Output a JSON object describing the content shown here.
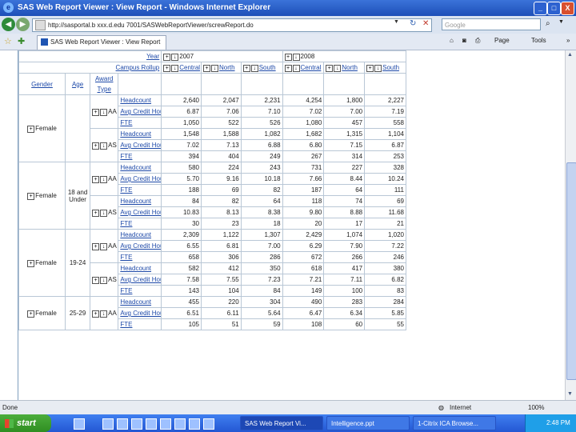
{
  "window": {
    "title": "SAS Web Report Viewer : View Report - Windows Internet Explorer",
    "icon": "ie-icon",
    "minimize": "_",
    "maximize": "□",
    "close": "X"
  },
  "address_bar": {
    "url": "http://sasportal.b xxx.d.edu 7001/SASWebReportViewer/screwReport.do",
    "search_placeholder": "Google"
  },
  "tabs": [
    {
      "label": "SAS Web Report Viewer : View Report"
    }
  ],
  "command_bar": {
    "page": "Page",
    "tools": "Tools"
  },
  "report": {
    "header": {
      "year_label": "Year",
      "year_2007": "2007",
      "year_2008": "2008",
      "campus_label": "Campus Rollup",
      "campuses": [
        "Central",
        "North",
        "South",
        "Central",
        "North",
        "South"
      ],
      "gender_label": "Gender",
      "age_label": "Age",
      "award_type_label": "Award Type"
    },
    "groups": [
      {
        "gender": "Female",
        "age": "",
        "rows": [
          {
            "type": "AA",
            "metric": "Headcount",
            "values": [
              "2,640",
              "2,047",
              "2,231",
              "4,254",
              "1,800",
              "2,227"
            ]
          },
          {
            "type": "",
            "metric": "Avg Credit Hours",
            "values": [
              "6.87",
              "7.06",
              "7.10",
              "7.02",
              "7.00",
              "7.19"
            ]
          },
          {
            "type": "",
            "metric": "FTE",
            "values": [
              "1,050",
              "522",
              "526",
              "1,080",
              "457",
              "558"
            ]
          },
          {
            "type": "AS",
            "metric": "Headcount",
            "values": [
              "1,548",
              "1,588",
              "1,082",
              "1,682",
              "1,315",
              "1,104"
            ]
          },
          {
            "type": "",
            "metric": "Avg Credit Hours",
            "values": [
              "7.02",
              "7.13",
              "6.88",
              "6.80",
              "7.15",
              "6.87"
            ]
          },
          {
            "type": "",
            "metric": "FTE",
            "values": [
              "394",
              "404",
              "249",
              "267",
              "314",
              "253"
            ]
          }
        ]
      },
      {
        "gender": "Female",
        "age": "18 and Under",
        "rows": [
          {
            "type": "AA",
            "metric": "Headcount",
            "values": [
              "580",
              "224",
              "243",
              "731",
              "227",
              "328"
            ]
          },
          {
            "type": "",
            "metric": "Avg Credit Hours",
            "values": [
              "5.70",
              "9.16",
              "10.18",
              "7.66",
              "8.44",
              "10.24"
            ]
          },
          {
            "type": "",
            "metric": "FTE",
            "values": [
              "188",
              "69",
              "82",
              "187",
              "64",
              "111"
            ]
          },
          {
            "type": "AS",
            "metric": "Headcount",
            "values": [
              "84",
              "82",
              "64",
              "118",
              "74",
              "69"
            ]
          },
          {
            "type": "",
            "metric": "Avg Credit Hours",
            "values": [
              "10.83",
              "8.13",
              "8.38",
              "9.80",
              "8.88",
              "11.68"
            ]
          },
          {
            "type": "",
            "metric": "FTE",
            "values": [
              "30",
              "23",
              "18",
              "20",
              "17",
              "21"
            ]
          }
        ]
      },
      {
        "gender": "Female",
        "age": "19-24",
        "rows": [
          {
            "type": "AA",
            "metric": "Headcount",
            "values": [
              "2,309",
              "1,122",
              "1,307",
              "2,429",
              "1,074",
              "1,020"
            ]
          },
          {
            "type": "",
            "metric": "Avg Credit Hours",
            "values": [
              "6.55",
              "6.81",
              "7.00",
              "6.29",
              "7.90",
              "7.22"
            ]
          },
          {
            "type": "",
            "metric": "FTE",
            "values": [
              "658",
              "306",
              "286",
              "672",
              "266",
              "246"
            ]
          },
          {
            "type": "AS",
            "metric": "Headcount",
            "values": [
              "582",
              "412",
              "350",
              "618",
              "417",
              "380"
            ]
          },
          {
            "type": "",
            "metric": "Avg Credit Hours",
            "values": [
              "7.58",
              "7.55",
              "7.23",
              "7.21",
              "7.11",
              "6.82"
            ]
          },
          {
            "type": "",
            "metric": "FTE",
            "values": [
              "143",
              "104",
              "84",
              "149",
              "100",
              "83"
            ]
          }
        ]
      },
      {
        "gender": "Female",
        "age": "25-29",
        "rows": [
          {
            "type": "AA",
            "metric": "Headcount",
            "values": [
              "455",
              "220",
              "304",
              "490",
              "283",
              "284"
            ]
          },
          {
            "type": "",
            "metric": "Avg Credit Hours",
            "values": [
              "6.51",
              "6.11",
              "5.64",
              "6.47",
              "6.34",
              "5.85"
            ]
          },
          {
            "type": "",
            "metric": "FTE",
            "values": [
              "105",
              "51",
              "59",
              "108",
              "60",
              "55"
            ]
          }
        ]
      }
    ]
  },
  "status": {
    "left": "Done",
    "zone": "Internet",
    "zoom": "100%"
  },
  "taskbar": {
    "start": "start",
    "buttons": [
      "SAS Web Report Vi...",
      "Intelligence.ppt",
      "1-Citrix ICA Browse..."
    ],
    "clock": "2:48 PM"
  }
}
